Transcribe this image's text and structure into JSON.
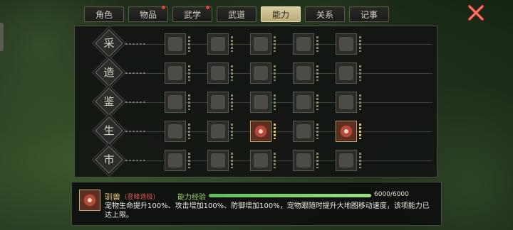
{
  "tabs": [
    {
      "label": "角色",
      "active": false,
      "badge": false
    },
    {
      "label": "物品",
      "active": false,
      "badge": true
    },
    {
      "label": "武学",
      "active": false,
      "badge": true
    },
    {
      "label": "武道",
      "active": false,
      "badge": false
    },
    {
      "label": "能力",
      "active": true,
      "badge": false
    },
    {
      "label": "关系",
      "active": false,
      "badge": false
    },
    {
      "label": "记事",
      "active": false,
      "badge": false
    }
  ],
  "close_icon": "close-x-icon",
  "ability_rows": [
    {
      "label": "采",
      "slots": [
        {
          "icon": "ore-icon",
          "active": false
        },
        {
          "icon": "pickaxe-icon",
          "active": false
        },
        {
          "icon": "basket-icon",
          "active": false
        },
        {
          "icon": "herb-icon",
          "active": false
        },
        {
          "icon": "jar-icon",
          "active": false
        }
      ]
    },
    {
      "label": "造",
      "slots": [
        {
          "icon": "anvil-icon",
          "active": false
        },
        {
          "icon": "cloth-icon",
          "active": false
        },
        {
          "icon": "pot-icon",
          "active": false
        },
        {
          "icon": "cart-icon",
          "active": false
        },
        {
          "icon": "tools-icon",
          "active": false
        }
      ]
    },
    {
      "label": "鉴",
      "slots": [
        {
          "icon": "scroll-icon",
          "active": false
        },
        {
          "icon": "book-icon",
          "active": false
        },
        {
          "icon": "gem-icon",
          "active": false
        },
        {
          "icon": "bowl-icon",
          "active": false
        },
        {
          "icon": "tome-icon",
          "active": false
        }
      ]
    },
    {
      "label": "生",
      "slots": [
        {
          "icon": "cooking-pot-icon",
          "active": false
        },
        {
          "icon": "fence-icon",
          "active": false
        },
        {
          "icon": "whip-icon",
          "active": true
        },
        {
          "icon": "fishing-net-icon",
          "active": false
        },
        {
          "icon": "whip-icon",
          "active": true
        }
      ]
    },
    {
      "label": "市",
      "slots": [
        {
          "icon": "money-bag-icon",
          "active": false
        },
        {
          "icon": "banner-icon",
          "active": false
        },
        {
          "icon": "coin-tray-icon",
          "active": false
        },
        {
          "icon": "chest-icon",
          "active": false
        },
        {
          "icon": "horn-icon",
          "active": false
        }
      ]
    }
  ],
  "detail": {
    "icon": "whip-icon",
    "name": "驯兽",
    "rank": "(登峰造极)",
    "exp_label": "能力经验",
    "exp_text": "6000/6000",
    "exp_fraction": 1.0,
    "description": "宠物生命提升100%、攻击增加100%、防御增加100%，宠物跟随时提升大地图移动速度，该项能力已达上限。"
  },
  "colors": {
    "accent_gold": "#e3c27a",
    "exp_green": "#9fd46e",
    "rank_red": "#d9534f",
    "close_red": "#e0443c"
  }
}
